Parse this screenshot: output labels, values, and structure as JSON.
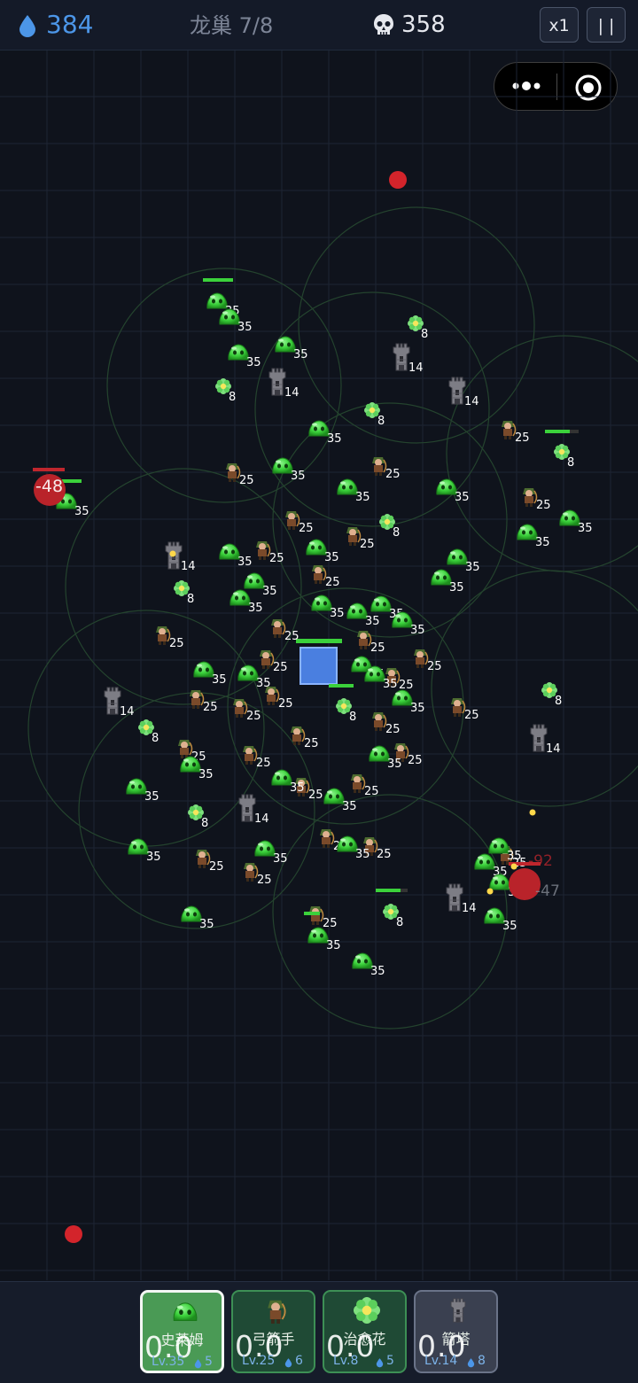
{
  "hud": {
    "water": "384",
    "level": "龙巢 7/8",
    "kills": "358",
    "speed": "x1",
    "pause": "| |"
  },
  "colors": {
    "water": "#4c96e8",
    "slime": "#3bd13b",
    "enemy": "#c0262d",
    "base": "#4a7fe0"
  },
  "icons": {
    "water": "water-drop-icon",
    "kills": "skull-icon",
    "more": "more-dots-icon",
    "close": "capsule-close-icon"
  },
  "damage_texts": [
    "-48",
    "-92",
    "-47"
  ],
  "cards": [
    {
      "name": "史莱姆",
      "cooldown": "0.0",
      "level": "Lv.35",
      "cost": "5",
      "icon": "slime-icon",
      "selected": true
    },
    {
      "name": "弓箭手",
      "cooldown": "0.0",
      "level": "Lv.25",
      "cost": "6",
      "icon": "archer-icon",
      "selected": false
    },
    {
      "name": "治愈花",
      "cooldown": "0.0",
      "level": "Lv.8",
      "cost": "5",
      "icon": "flower-icon",
      "selected": false
    },
    {
      "name": "箭塔",
      "cooldown": "0.0",
      "level": "Lv.14",
      "cost": "8",
      "icon": "tower-icon",
      "selected": false
    }
  ],
  "units": {
    "slime_level": "35",
    "archer_level": "25",
    "flower_level": "8",
    "tower_level": "14"
  }
}
